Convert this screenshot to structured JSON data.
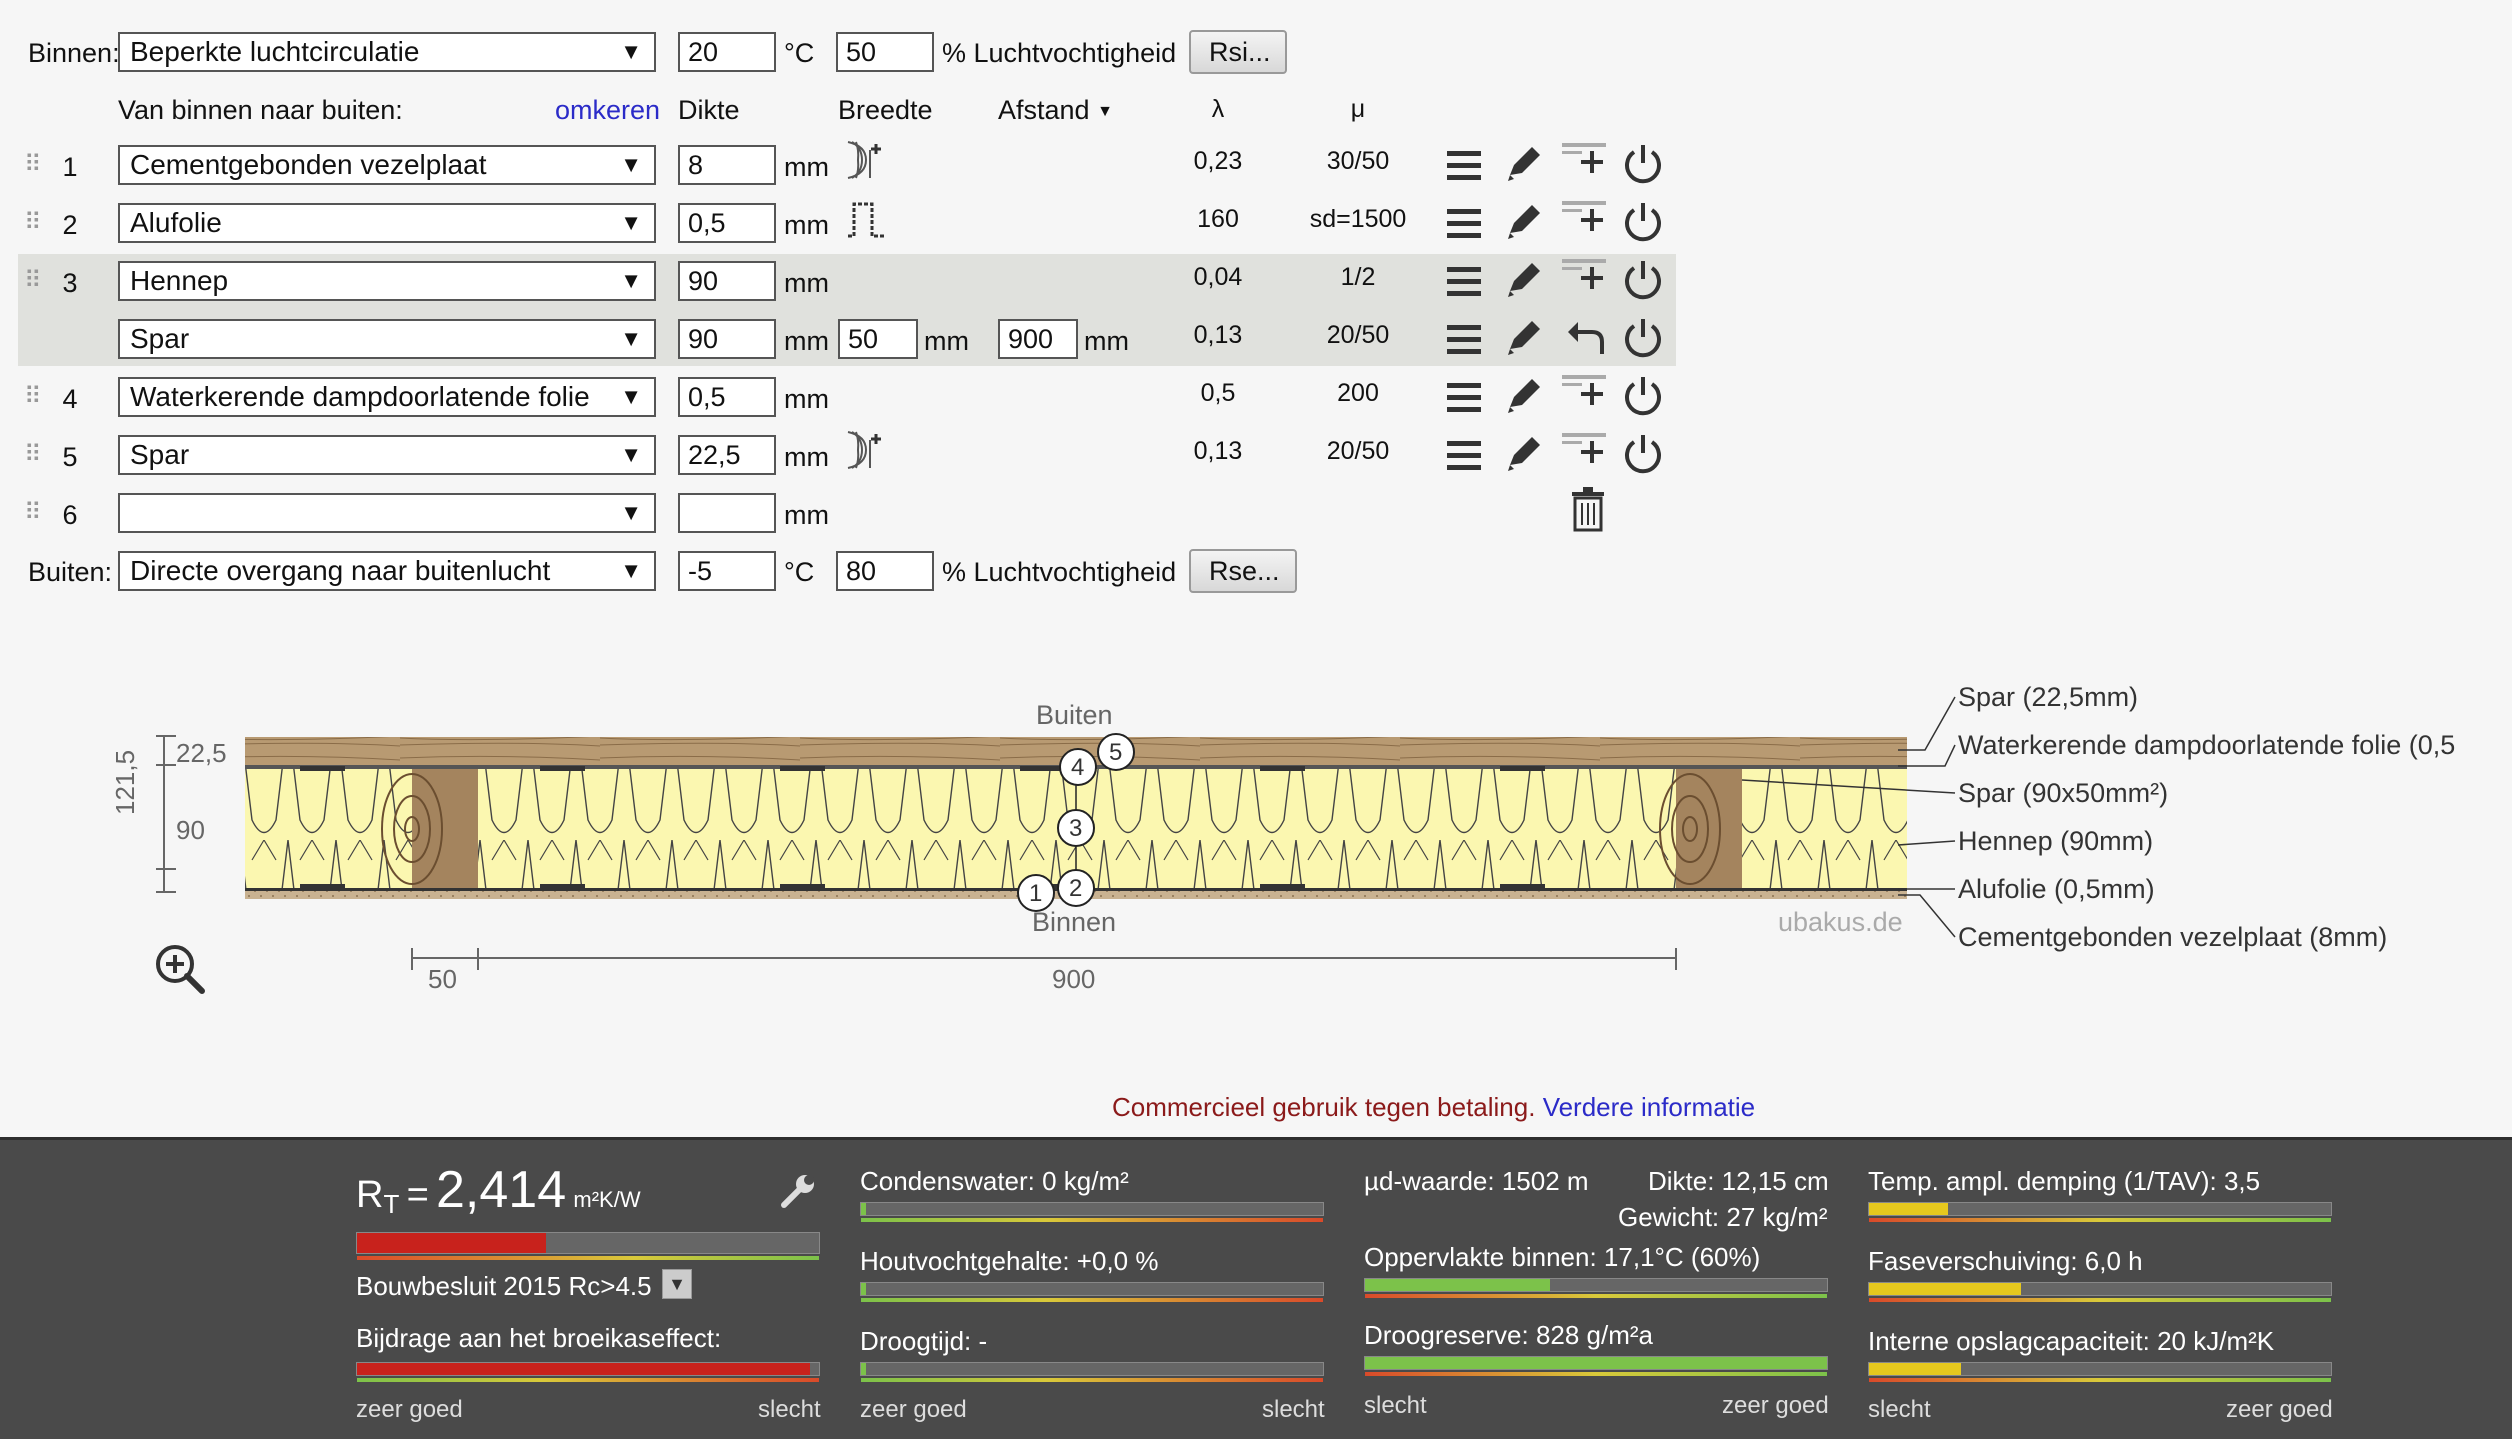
{
  "inside": {
    "label": "Binnen:",
    "condition": "Beperkte luchtcirculatie",
    "temperature": "20",
    "temp_unit": "°C",
    "humidity": "50",
    "humidity_label": "% Luchtvochtigheid",
    "rsi_button": "Rsi..."
  },
  "header": {
    "direction": "Van binnen naar buiten:",
    "reverse_link": "omkeren",
    "thickness": "Dikte",
    "width": "Breedte",
    "spacing": "Afstand",
    "lambda": "λ",
    "mu": "μ"
  },
  "layers": [
    {
      "num": "1",
      "material": "Cementgebonden vezelplaat",
      "thickness": "8",
      "unit": "mm",
      "lambda": "0,23",
      "mu": "30/50"
    },
    {
      "num": "2",
      "material": "Alufolie",
      "thickness": "0,5",
      "unit": "mm",
      "lambda": "160",
      "mu": "sd=1500"
    },
    {
      "num": "3",
      "material": "Hennep",
      "thickness": "90",
      "unit": "mm",
      "lambda": "0,04",
      "mu": "1/2"
    },
    {
      "num": "",
      "material": "Spar",
      "thickness": "90",
      "unit": "mm",
      "width": "50",
      "width_unit": "mm",
      "spacing": "900",
      "spacing_unit": "mm",
      "lambda": "0,13",
      "mu": "20/50"
    },
    {
      "num": "4",
      "material": "Waterkerende dampdoorlatende folie",
      "thickness": "0,5",
      "unit": "mm",
      "lambda": "0,5",
      "mu": "200"
    },
    {
      "num": "5",
      "material": "Spar",
      "thickness": "22,5",
      "unit": "mm",
      "lambda": "0,13",
      "mu": "20/50"
    },
    {
      "num": "6",
      "material": "",
      "thickness": "",
      "unit": "mm"
    }
  ],
  "outside": {
    "label": "Buiten:",
    "condition": "Directe overgang naar buitenlucht",
    "temperature": "-5",
    "temp_unit": "°C",
    "humidity": "80",
    "humidity_label": "% Luchtvochtigheid",
    "rse_button": "Rse..."
  },
  "diagram": {
    "top_label": "Buiten",
    "bottom_label": "Binnen",
    "watermark": "ubakus.de",
    "dim_total": "121,5",
    "dim_top": "22,5",
    "dim_insul": "90",
    "dim_width": "50",
    "dim_spacing": "900",
    "markers": [
      "1",
      "2",
      "3",
      "4",
      "5"
    ],
    "legend": [
      "Spar (22,5mm)",
      "Waterkerende dampdoorlatende folie (0,5",
      "Spar (90x50mm²)",
      "Hennep (90mm)",
      "Alufolie (0,5mm)",
      "Cementgebonden vezelplaat (8mm)"
    ]
  },
  "notice": {
    "text": "Commercieel gebruik tegen betaling.",
    "link": "Verdere informatie"
  },
  "results": {
    "rt_symbol": "R",
    "rt_sub": "T",
    "rt_eq": "=",
    "rt_value": "2,414",
    "rt_unit": "m²K/W",
    "rt_fill": 0.41,
    "standard": "Bouwbesluit 2015 Rc>4.5",
    "greenhouse": "Bijdrage aan het broeikaseffect:",
    "greenhouse_fill": 0.98,
    "condensate": "Condenswater: 0 kg/m²",
    "condensate_fill": 0.01,
    "wood_moisture": "Houtvochtgehalte: +0,0 %",
    "wood_moisture_fill": 0.01,
    "drying_time": "Droogtijd: -",
    "drying_time_fill": 0.01,
    "scale_good": "zeer goed",
    "scale_bad": "slecht",
    "sd_value": "µd-waarde: 1502 m",
    "thickness": "Dikte: 12,15 cm",
    "weight": "Gewicht: 27 kg/m²",
    "surface_inside": "Oppervlakte binnen: 17,1°C (60%)",
    "surface_fill": 0.4,
    "drying_reserve": "Droogreserve: 828 g/m²a",
    "drying_reserve_fill": 1.0,
    "scale2_bad": "slecht",
    "scale2_good": "zeer goed",
    "temp_damping": "Temp. ampl. demping (1/TAV): 3,5",
    "temp_damping_fill": 0.17,
    "phase_shift": "Faseverschuiving: 6,0 h",
    "phase_shift_fill": 0.33,
    "storage": "Interne opslagcapaciteit: 20 kJ/m²K",
    "storage_fill": 0.2,
    "scale3_bad": "slecht",
    "scale3_good": "zeer goed"
  },
  "colors": {
    "link": "#2b2bc8",
    "notice": "#8b1a1a",
    "bar_red": "#c8221c",
    "bar_green": "#7cc24a",
    "bar_yellow": "#e6c81e",
    "insulation": "#fbf7b0",
    "wood": "#b89a72"
  }
}
